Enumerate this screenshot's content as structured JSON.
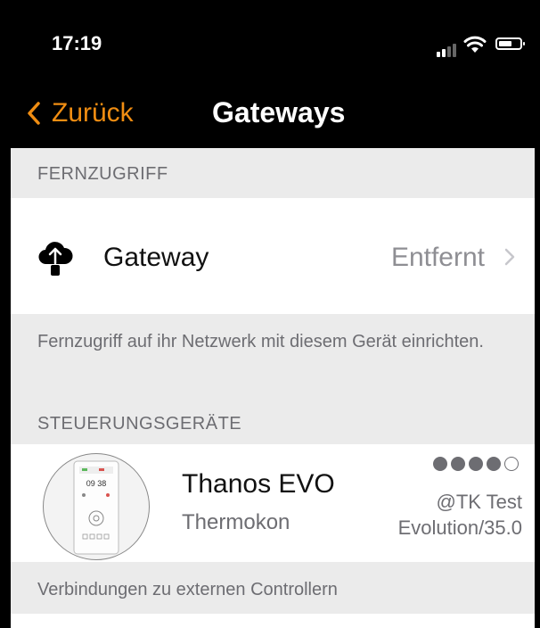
{
  "status_bar": {
    "time": "17:19"
  },
  "nav": {
    "back_label": "Zurück",
    "title": "Gateways"
  },
  "sections": {
    "remote": {
      "header": "FERNZUGRIFF",
      "gateway_label": "Gateway",
      "gateway_value": "Entfernt",
      "footer": "Fernzugriff auf ihr Netzwerk mit diesem Gerät einrichten."
    },
    "controllers": {
      "header": "STEUERUNGSGERÄTE",
      "device": {
        "name": "Thanos EVO",
        "vendor": "Thermokon",
        "signal_bars_filled": 4,
        "signal_bars_total": 5,
        "location": "@TK Test",
        "firmware": "Evolution/35.0",
        "display_time": "09 38"
      },
      "footer": "Verbindungen zu externen Controllern"
    }
  },
  "colors": {
    "accent": "#f08d12",
    "secondary_text": "#6d6d72",
    "background": "#ebebeb"
  },
  "icons": [
    "chevron-left-icon",
    "cloud-upload-icon",
    "chevron-right-icon",
    "signal-icon",
    "wifi-icon",
    "battery-icon"
  ]
}
